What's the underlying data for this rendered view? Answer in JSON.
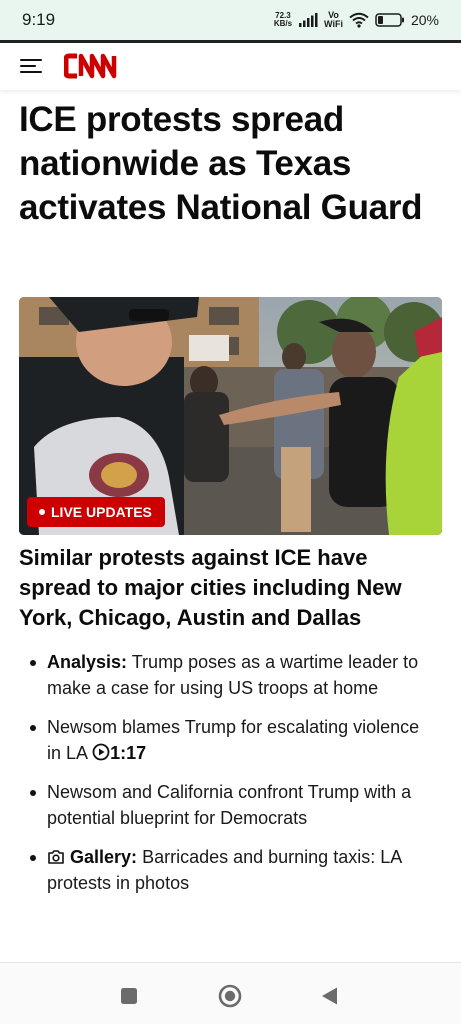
{
  "status_bar": {
    "time": "9:19",
    "net_speed_value": "72.3",
    "net_speed_unit": "KB/s",
    "vowifi_top": "Vo",
    "vowifi_bottom": "WiFi",
    "battery": "20%"
  },
  "header": {
    "logo": "CNN",
    "icons": [
      "menu-icon",
      "cnn-logo"
    ]
  },
  "article": {
    "headline": "ICE protests spread nationwide as Texas activates National Guard",
    "live_badge": "LIVE UPDATES",
    "subheadline": "Similar protests against ICE have spread to major cities including New York, Chicago, Austin and Dallas",
    "related": [
      {
        "prefix": "Analysis:",
        "text": "Trump poses as a wartime leader to make a case for using US troops at home"
      },
      {
        "text": "Newsom blames Trump for escalating violence in LA",
        "video_icon": "play-circle-icon",
        "duration": "1:17"
      },
      {
        "text": "Newsom and California confront Trump with a potential blueprint for Democrats"
      },
      {
        "camera_icon": "camera-icon",
        "prefix": "Gallery:",
        "text": "Barricades and burning taxis: LA protests in photos"
      }
    ]
  },
  "nav_bar": {
    "icons": [
      "recents-square-icon",
      "home-circle-icon",
      "back-triangle-icon"
    ]
  },
  "colors": {
    "status_bg": "#e9f6ef",
    "brand_red": "#cc0000",
    "text": "#0c0c0c"
  }
}
